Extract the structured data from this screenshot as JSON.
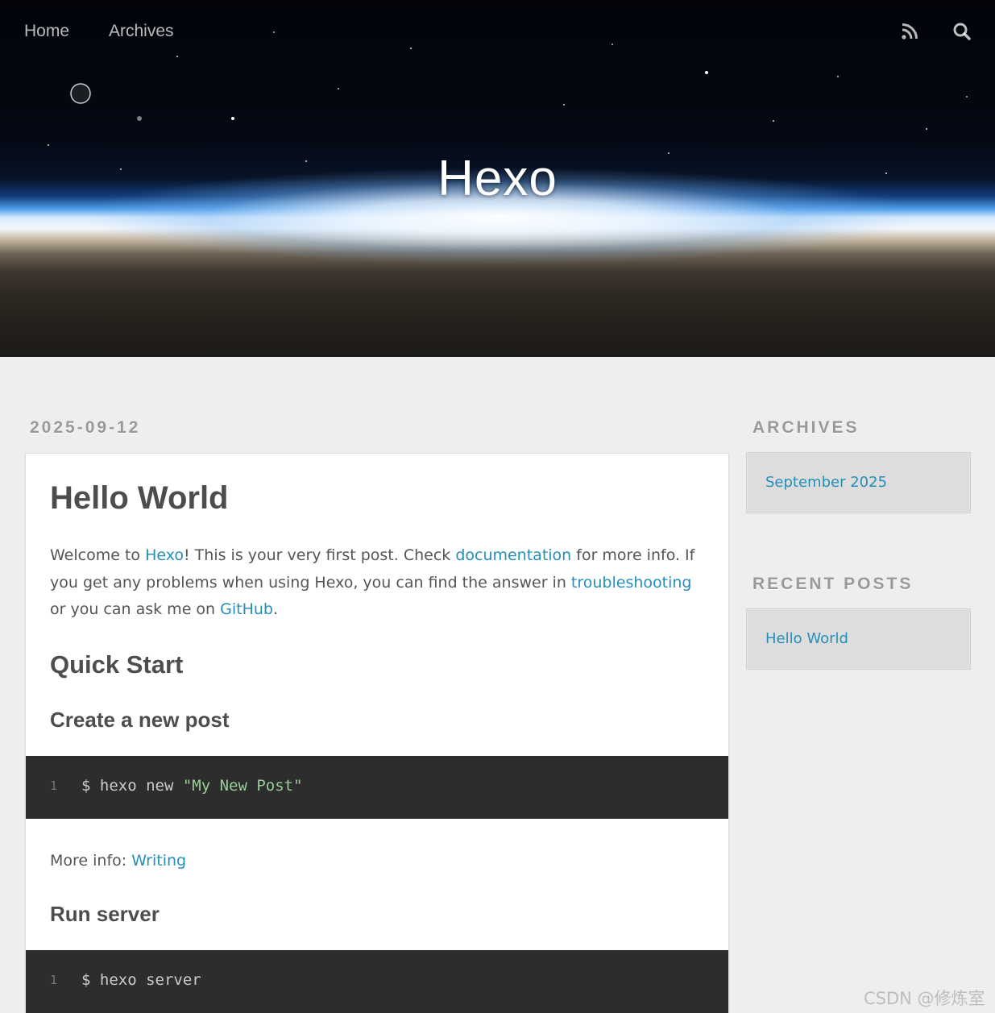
{
  "nav": {
    "home": "Home",
    "archives": "Archives"
  },
  "header": {
    "title": "Hexo",
    "rss_icon": "rss-icon",
    "search_icon": "search-icon"
  },
  "post": {
    "date": "2025-09-12",
    "title": "Hello World",
    "intro": [
      {
        "text": "Welcome to ",
        "link": false
      },
      {
        "text": "Hexo",
        "link": true
      },
      {
        "text": "! This is your very first post. Check ",
        "link": false
      },
      {
        "text": "documentation",
        "link": true
      },
      {
        "text": " for more info. If you get any problems when using Hexo, you can find the answer in ",
        "link": false
      },
      {
        "text": "troubleshooting",
        "link": true
      },
      {
        "text": " or you can ask me on ",
        "link": false
      },
      {
        "text": "GitHub",
        "link": true
      },
      {
        "text": ".",
        "link": false
      }
    ],
    "quick_start": "Quick Start",
    "create_heading": "Create a new post",
    "code1": {
      "line_no": "1",
      "prefix": "$ hexo new ",
      "string": "\"My New Post\""
    },
    "more_info_label": "More info: ",
    "more_info_link": "Writing",
    "run_heading": "Run server",
    "code2": {
      "line_no": "1",
      "prefix": "$ hexo server",
      "string": ""
    }
  },
  "sidebar": {
    "archives_title": "ARCHIVES",
    "archive_item": "September 2025",
    "recent_title": "RECENT POSTS",
    "recent_item": "Hello World"
  },
  "watermark": "CSDN @修炼室",
  "colors": {
    "link": "#258fb8",
    "code_bg": "#2d2d2d",
    "code_string": "#99cc99",
    "page_bg": "#eeeeee"
  }
}
